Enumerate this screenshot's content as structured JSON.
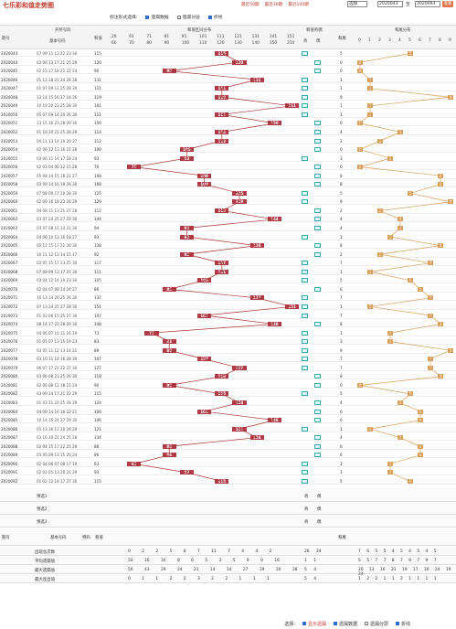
{
  "title": "七乐彩和值走势图",
  "links": [
    "最近50期",
    "最近30期",
    "最近100期"
  ],
  "select_value": "选择",
  "from_issue": "2020043",
  "to_label": "至",
  "to_issue": "2020093",
  "search_label": "查看",
  "options": {
    "label": "标注形式选择:",
    "o1": "遗漏数据",
    "o2": "遗漏分层",
    "o3": "折线"
  },
  "headers": {
    "issue": "期号",
    "open": "开奖号码",
    "sum": "和值",
    "zone": "和值区间分布",
    "odd": "和值奇偶",
    "odd_sub": [
      "奇",
      "偶"
    ],
    "tail": "和尾",
    "tail_dist": "和尾分布",
    "num_col": "基本号码",
    "special": "特码"
  },
  "ranges": [
    "20",
    "61",
    "71",
    "81",
    "91",
    "101",
    "111",
    "121",
    "131",
    "141",
    "151"
  ],
  "ranges2": [
    "60",
    "70",
    "80",
    "90",
    "100",
    "110",
    "120",
    "130",
    "140",
    "150",
    "210"
  ],
  "tails": [
    "0",
    "1",
    "2",
    "3",
    "4",
    "5",
    "6",
    "7",
    "8",
    "9"
  ],
  "rows": [
    {
      "issue": "2020043",
      "nums": "07 09 11 13 22 23 30",
      "sum": 115
    },
    {
      "issue": "2020044",
      "nums": "03 06 13 17 21 25 29",
      "sum": 130
    },
    {
      "issue": "2020045",
      "nums": "02 15 17 18 21 22 24",
      "sum": 90
    },
    {
      "issue": "2020046",
      "nums": "01 13 18 21 24 26 28",
      "sum": 131
    },
    {
      "issue": "2020047",
      "nums": "01 07 09 11 25 28 30",
      "sum": 111
    },
    {
      "issue": "2020048",
      "nums": "13 14 15 16 17 18 26",
      "sum": 119
    },
    {
      "issue": "2020049",
      "nums": "10 19 20 23 25 28 30",
      "sum": 161
    },
    {
      "issue": "2020050",
      "nums": "05 07 09 14 20 26 30",
      "sum": 111
    },
    {
      "issue": "2020051",
      "nums": "13 15 16 23 28 29 30",
      "sum": 150
    },
    {
      "issue": "2020052",
      "nums": "01 10 20 21 25 28 29",
      "sum": 114
    },
    {
      "issue": "2020053",
      "nums": "04 11 13 14 19 20 27",
      "sum": 112
    },
    {
      "issue": "2020054",
      "nums": "02 06 12 13 16 21 28",
      "sum": 100
    },
    {
      "issue": "2020055",
      "nums": "03 06 11 14 17 18 24",
      "sum": 93
    },
    {
      "issue": "2020056",
      "nums": "02 03 04 06 12 15 28",
      "sum": 70
    },
    {
      "issue": "2020057",
      "nums": "05 08 14 15 18 22 27",
      "sum": 108
    },
    {
      "issue": "2020058",
      "nums": "03 09 14 16 19 26 30",
      "sum": 108
    },
    {
      "issue": "2020059",
      "nums": "07 08 09 17 20 28 30",
      "sum": 125
    },
    {
      "issue": "2020060",
      "nums": "02 09 16 18 23 26 29",
      "sum": 129
    },
    {
      "issue": "2020061",
      "nums": "04 08 11 13 21 27 28",
      "sum": 112
    },
    {
      "issue": "2020062",
      "nums": "03 07 24 25 27 29 30",
      "sum": 144
    },
    {
      "issue": "2020063",
      "nums": "03 07 08 11 14 21 30",
      "sum": 94
    },
    {
      "issue": "2020064",
      "nums": "04 06 10 13 16 18 27",
      "sum": 93
    },
    {
      "issue": "2020065",
      "nums": "05 12 15 17 21 26 30",
      "sum": 138
    },
    {
      "issue": "2020066",
      "nums": "10 11 12 13 14 15 17",
      "sum": 92
    },
    {
      "issue": "2020067",
      "nums": "02 05 15 17 23 25 30",
      "sum": 117
    },
    {
      "issue": "2020068",
      "nums": "07 08 09 13 17 25 30",
      "sum": 111
    },
    {
      "issue": "2020069",
      "nums": "03 04 12 14 19 23 30",
      "sum": 105
    },
    {
      "issue": "2020070",
      "nums": "02 04 07 08 14 24 27",
      "sum": 86
    },
    {
      "issue": "2020071",
      "nums": "10 13 14 20 25 26 30",
      "sum": 137
    },
    {
      "issue": "2020072",
      "nums": "07 13 24 25 27 28 30",
      "sum": 151
    },
    {
      "issue": "2020073",
      "nums": "01 03 06 15 25 27 30",
      "sum": 107
    },
    {
      "issue": "2020074",
      "nums": "08 14 17 22 28 29 30",
      "sum": 148
    },
    {
      "issue": "2020075",
      "nums": "04 06 07 10 11 16 19",
      "sum": 73
    },
    {
      "issue": "2020076",
      "nums": "01 05 07 13 15 19 23",
      "sum": 83
    },
    {
      "issue": "2020077",
      "nums": "03 05 11 12 13 14 21",
      "sum": 89
    },
    {
      "issue": "2020078",
      "nums": "03 10 11 14 16 28 30",
      "sum": 107
    },
    {
      "issue": "2020079",
      "nums": "06 07 17 21 22 27 30",
      "sum": 127
    },
    {
      "issue": "2020080",
      "nums": "03 06 08 23 25 26 30",
      "sum": 118
    },
    {
      "issue": "2020081",
      "nums": "02 06 08 12 18 21 24",
      "sum": 90
    },
    {
      "issue": "2020082",
      "nums": "03 09 14 17 21 22 29",
      "sum": 115
    },
    {
      "issue": "2020083",
      "nums": "01 03 21 22 25 28 29",
      "sum": 124
    },
    {
      "issue": "2020084",
      "nums": "04 09 14 16 18 22 21",
      "sum": 106
    },
    {
      "issue": "2020085",
      "nums": "10 14 15 24 27 29 30",
      "sum": 146
    },
    {
      "issue": "2020086",
      "nums": "05 13 16 17 20 24 29",
      "sum": 121
    },
    {
      "issue": "2020087",
      "nums": "03 16 20 22 24 25 28",
      "sum": 134
    },
    {
      "issue": "2020088",
      "nums": "02 04 15 17 22 25 29",
      "sum": 86
    },
    {
      "issue": "2020089",
      "nums": "03 05 09 11 15 20 24",
      "sum": 86
    },
    {
      "issue": "2020090",
      "nums": "02 04 06 07 08 17 19",
      "sum": 63
    },
    {
      "issue": "2020091",
      "nums": "02 03 05 13 20 21 29",
      "sum": 93
    },
    {
      "issue": "2020092",
      "nums": "01 02 12 14 17 27 30",
      "sum": 115
    }
  ],
  "predict": [
    "预选1",
    "预选2",
    "预选3"
  ],
  "odd_mark": "奇",
  "even_mark": "偶",
  "stats": [
    {
      "label": "出现总次数",
      "vals": "0 2 2 5 6 7 11 7 4 4 2",
      "odd": "26 24",
      "tails": "7 6 5 5 4 5 4 5 4 5"
    },
    {
      "label": "平均遗漏值",
      "vals": "50 16 16 8 6 5 3 5 9 9 16",
      "odd": "1 1",
      "tails": "5 5 7 7 8 7 9 7 9 7"
    },
    {
      "label": "最大遗漏值",
      "vals": "50 43 29 24 21 14 14 27 19 20 28",
      "odd": "5 4",
      "tails": "20 13 16 21 19 17 16 24 19 24"
    },
    {
      "label": "最大连出值",
      "vals": "0 1 1 2 2 3 2 2 1 1 1",
      "odd": "5 4",
      "tails": "1 2 2 1 1 2 1 1 1 1"
    }
  ],
  "footer": {
    "label": "选择:",
    "o1": "显示遗漏",
    "o2": "遗漏数据",
    "o3": "遗漏分层",
    "o4": "折线"
  }
}
